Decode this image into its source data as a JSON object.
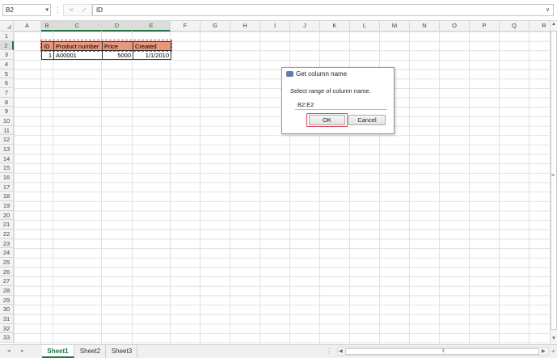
{
  "formula_bar": {
    "name_box": "B2",
    "separator": "⋮",
    "cancel_glyph": "✕",
    "enter_glyph": "✓",
    "formula": "ID"
  },
  "columns": [
    "A",
    "B",
    "C",
    "D",
    "E",
    "F",
    "G",
    "H",
    "I",
    "J",
    "K",
    "L",
    "M",
    "N",
    "O",
    "P",
    "Q",
    "R"
  ],
  "rows": [
    "1",
    "2",
    "3",
    "4",
    "5",
    "6",
    "7",
    "8",
    "9",
    "10",
    "11",
    "12",
    "13",
    "14",
    "15",
    "16",
    "17",
    "18",
    "19",
    "20",
    "21",
    "22",
    "23",
    "24",
    "25",
    "26",
    "27",
    "28",
    "29",
    "30",
    "31",
    "32",
    "33"
  ],
  "table": {
    "header": [
      "ID",
      "Product number",
      "Price",
      "Created"
    ],
    "row": [
      "1",
      "A00001",
      "5000",
      "1/1/2010"
    ]
  },
  "dialog": {
    "title": "Get column name",
    "message": "Select range of column name.",
    "input_value": "B2:E2",
    "ok_label": "OK",
    "cancel_label": "Cancel"
  },
  "sheets": [
    "Sheet1",
    "Sheet2",
    "Sheet3"
  ],
  "active_sheet": "Sheet1",
  "colors": {
    "accent": "#217346",
    "header_fill": "#e9967a",
    "highlight": "#d9475f"
  },
  "icons": {
    "dialog": "dialog-window-icon",
    "dropdown": "chevron-down-icon"
  }
}
